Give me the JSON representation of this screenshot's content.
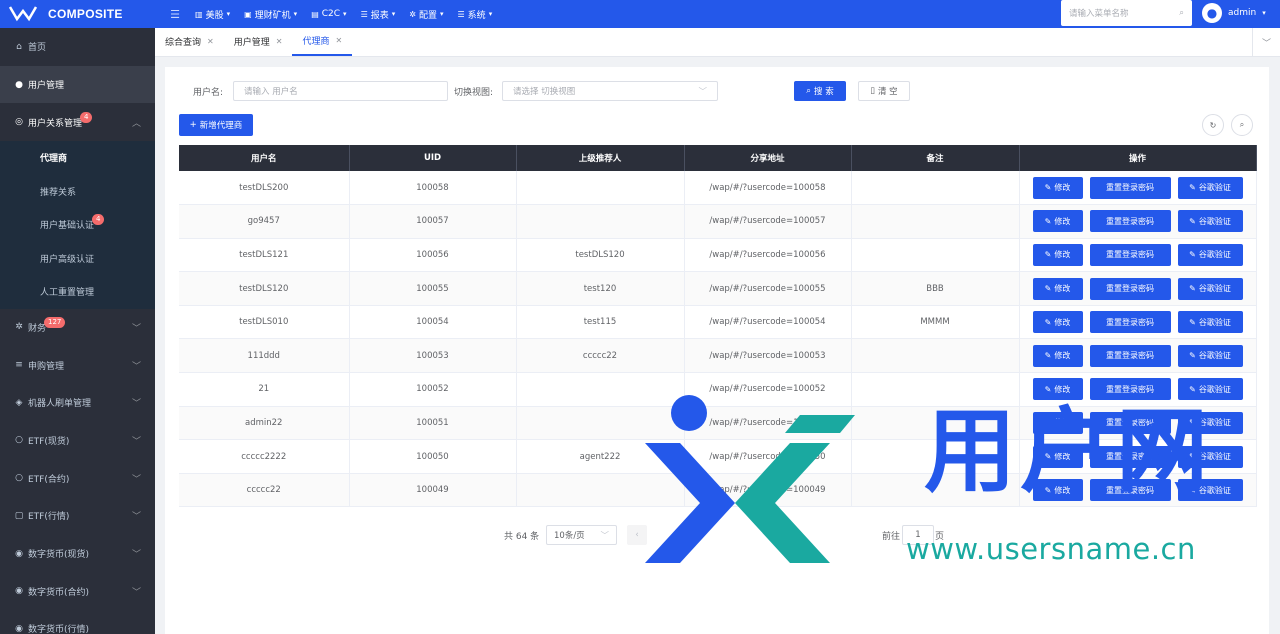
{
  "app": {
    "logo_text": "COMPOSITE"
  },
  "sidebar": {
    "items": [
      {
        "label": "首页",
        "icon": "home-icon"
      },
      {
        "label": "用户管理",
        "icon": "user-icon"
      },
      {
        "label": "用户关系管理",
        "icon": "user-group-icon",
        "badge": "4"
      }
    ],
    "subitems": [
      {
        "label": "代理商"
      },
      {
        "label": "推荐关系"
      },
      {
        "label": "用户基础认证",
        "badge": "4"
      },
      {
        "label": "用户高级认证"
      },
      {
        "label": "人工重置管理"
      }
    ],
    "groups": [
      {
        "label": "财务",
        "badge": "127"
      },
      {
        "label": "申购管理"
      },
      {
        "label": "机器人刷单管理"
      },
      {
        "label": "ETF(现货)"
      },
      {
        "label": "ETF(合约)"
      },
      {
        "label": "ETF(行情)"
      },
      {
        "label": "数字货币(现货)"
      },
      {
        "label": "数字货币(合约)"
      },
      {
        "label": "数字货币(行情)"
      }
    ]
  },
  "topbar": {
    "nav": [
      {
        "label": "美股"
      },
      {
        "label": "理财矿机"
      },
      {
        "label": "C2C"
      },
      {
        "label": "报表"
      },
      {
        "label": "配置"
      },
      {
        "label": "系统"
      }
    ],
    "search_placeholder": "请输入菜单名称",
    "username": "admin"
  },
  "tabs": [
    {
      "label": "综合查询"
    },
    {
      "label": "用户管理"
    },
    {
      "label": "代理商"
    }
  ],
  "filters": {
    "username_label": "用户名:",
    "username_placeholder": "请输入 用户名",
    "view_label": "切换视图:",
    "view_placeholder": "请选择 切换视图",
    "search_button": "搜 索",
    "reset_button": "清 空",
    "add_button": "新增代理商"
  },
  "table": {
    "columns": [
      "用户名",
      "UID",
      "上级推荐人",
      "分享地址",
      "备注",
      "操作"
    ],
    "action_labels": {
      "edit": "修改",
      "reset_password": "重置登录密码",
      "google_auth": "谷歌验证"
    },
    "rows": [
      {
        "username": "testDLS200",
        "uid": "100058",
        "referrer": "",
        "share": "/wap/#/?usercode=100058",
        "remark": ""
      },
      {
        "username": "go9457",
        "uid": "100057",
        "referrer": "",
        "share": "/wap/#/?usercode=100057",
        "remark": ""
      },
      {
        "username": "testDLS121",
        "uid": "100056",
        "referrer": "testDLS120",
        "share": "/wap/#/?usercode=100056",
        "remark": ""
      },
      {
        "username": "testDLS120",
        "uid": "100055",
        "referrer": "test120",
        "share": "/wap/#/?usercode=100055",
        "remark": "BBB"
      },
      {
        "username": "testDLS010",
        "uid": "100054",
        "referrer": "test115",
        "share": "/wap/#/?usercode=100054",
        "remark": "MMMM"
      },
      {
        "username": "111ddd",
        "uid": "100053",
        "referrer": "ccccc22",
        "share": "/wap/#/?usercode=100053",
        "remark": ""
      },
      {
        "username": "21",
        "uid": "100052",
        "referrer": "",
        "share": "/wap/#/?usercode=100052",
        "remark": ""
      },
      {
        "username": "admin22",
        "uid": "100051",
        "referrer": "",
        "share": "/wap/#/?usercode=100051",
        "remark": ""
      },
      {
        "username": "ccccc2222",
        "uid": "100050",
        "referrer": "agent222",
        "share": "/wap/#/?usercode=100050",
        "remark": ""
      },
      {
        "username": "ccccc22",
        "uid": "100049",
        "referrer": "",
        "share": "/wap/#/?usercode=100049",
        "remark": ""
      }
    ]
  },
  "pagination": {
    "total": "共 64 条",
    "page_size": "10条/页",
    "goto_label": "前往",
    "current_page": "1",
    "page_unit": "页"
  },
  "watermark": {
    "brand_cn": "用户网",
    "url": "www.usersname.cn"
  },
  "colors": {
    "primary": "#2458ea",
    "sidebar_bg": "#2b2f3a",
    "badge": "#f56c6c",
    "watermark_teal": "#1aa9a0"
  }
}
